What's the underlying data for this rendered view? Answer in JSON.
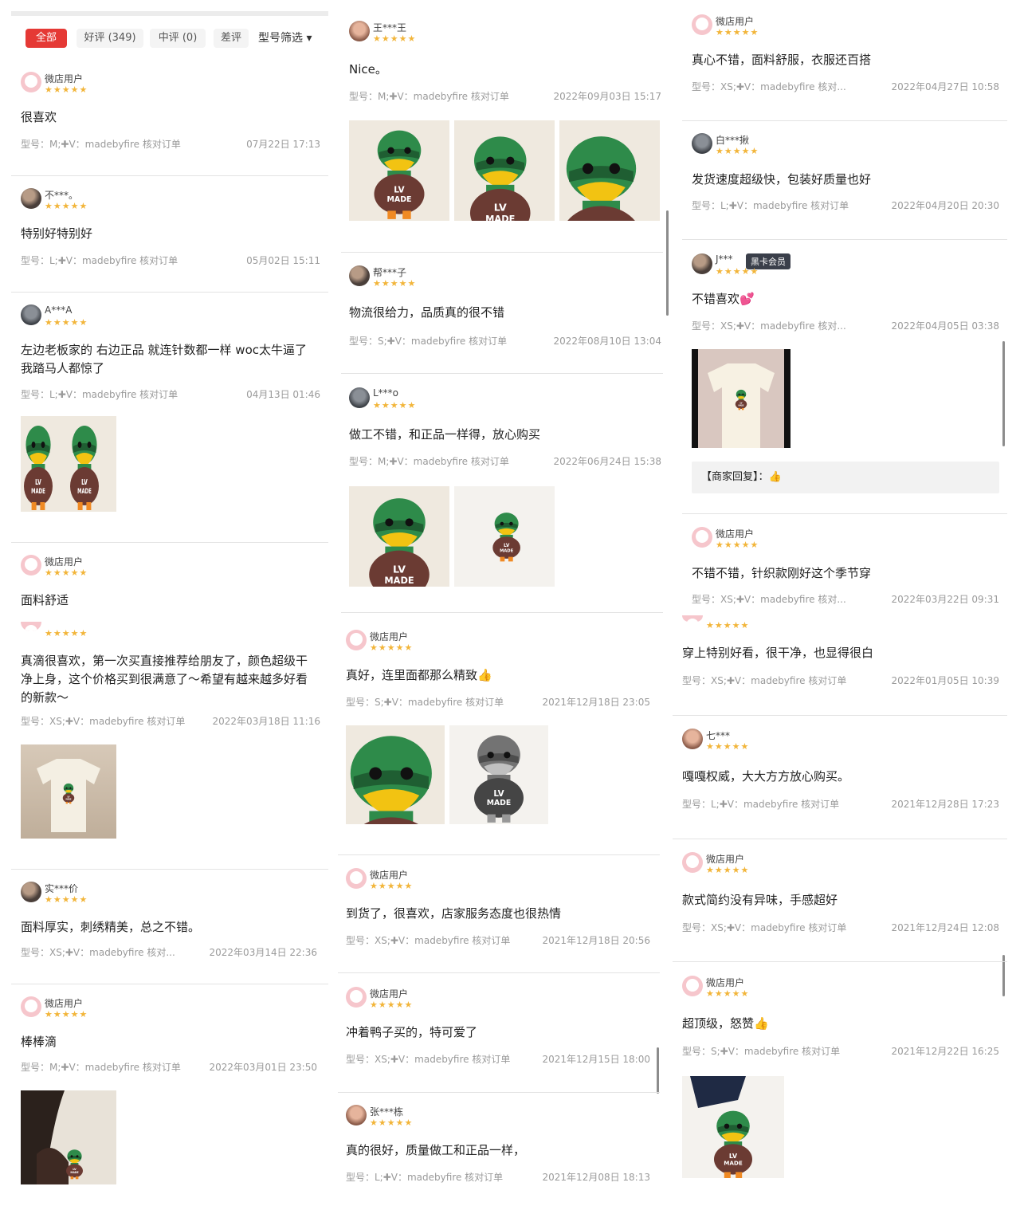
{
  "filters": {
    "tabs": [
      {
        "label": "全部"
      },
      {
        "label": "好评 (349)"
      },
      {
        "label": "中评 (0)"
      },
      {
        "label": "差评"
      }
    ],
    "dropdown": "型号筛选 ▾"
  },
  "colors": {
    "accent": "#e53935",
    "star": "#f2b53a"
  },
  "columns": [
    {
      "reviews": [
        {
          "user": "微店用户",
          "stars": "★★★★★",
          "content": "很喜欢",
          "meta": "型号：M;✚V：madebyfire 核对订单",
          "date": "07月22日 17:13"
        },
        {
          "user": "不***。",
          "stars": "★★★★★",
          "content": "特别好特别好",
          "meta": "型号：L;✚V：madebyfire 核对订单",
          "date": "05月02日 15:11"
        },
        {
          "user": "A***A",
          "stars": "★★★★★",
          "content": "左边老板家的 右边正品 就连针数都一样 woc太牛逼了 我踏马人都惊了",
          "meta": "型号：L;✚V：madebyfire 核对订单",
          "date": "04月13日 01:46"
        },
        {
          "user": "微店用户",
          "stars": "★★★★★",
          "content": "面料舒适",
          "meta": "",
          "date": ""
        },
        {
          "user": "微店用户",
          "stars": "★★★★★",
          "content": "真滴很喜欢，第一次买直接推荐给朋友了，颜色超级干净上身，这个价格买到很满意了～希望有越来越多好看的新款～",
          "meta": "型号：XS;✚V：madebyfire 核对订单",
          "date": "2022年03月18日 11:16"
        },
        {
          "user": "实***价",
          "stars": "★★★★★",
          "content": "面料厚实，刺绣精美，总之不错。",
          "meta": "型号：XS;✚V：madebyfire 核对...",
          "date": "2022年03月14日 22:36"
        },
        {
          "user": "微店用户",
          "stars": "★★★★★",
          "content": "棒棒滴",
          "meta": "型号：M;✚V：madebyfire 核对订单",
          "date": "2022年03月01日 23:50"
        }
      ]
    },
    {
      "reviews": [
        {
          "user": "王***王",
          "stars": "★★★★★",
          "content": "Nice。",
          "meta": "型号：M;✚V：madebyfire 核对订单",
          "date": "2022年09月03日 15:17"
        },
        {
          "user": "帮***子",
          "stars": "★★★★★",
          "content": "物流很给力，品质真的很不错",
          "meta": "型号：S;✚V：madebyfire 核对订单",
          "date": "2022年08月10日 13:04"
        },
        {
          "user": "L***o",
          "stars": "★★★★★",
          "content": "做工不错，和正品一样得，放心购买",
          "meta": "型号：M;✚V：madebyfire 核对订单",
          "date": "2022年06月24日 15:38"
        },
        {
          "user": "微店用户",
          "stars": "★★★★★",
          "content": "真好，连里面都那么精致👍",
          "meta": "型号：S;✚V：madebyfire 核对订单",
          "date": "2021年12月18日 23:05"
        },
        {
          "user": "微店用户",
          "stars": "★★★★★",
          "content": "到货了，很喜欢，店家服务态度也很热情",
          "meta": "型号：XS;✚V：madebyfire 核对订单",
          "date": "2021年12月18日 20:56"
        },
        {
          "user": "微店用户",
          "stars": "★★★★★",
          "content": "冲着鸭子买的，特可爱了",
          "meta": "型号：XS;✚V：madebyfire 核对订单",
          "date": "2021年12月15日 18:00"
        },
        {
          "user": "张***栋",
          "stars": "★★★★★",
          "content": "真的很好，质量做工和正品一样，",
          "meta": "型号：L;✚V：madebyfire 核对订单",
          "date": "2021年12月08日 18:13"
        }
      ]
    },
    {
      "reviews": [
        {
          "user": "微店用户",
          "stars": "★★★★★",
          "content": "真心不错，面料舒服，衣服还百搭",
          "meta": "型号：XS;✚V：madebyfire 核对...",
          "date": "2022年04月27日 10:58"
        },
        {
          "user": "白***揪",
          "stars": "★★★★★",
          "content": "发货速度超级快，包装好质量也好",
          "meta": "型号：L;✚V：madebyfire 核对订单",
          "date": "2022年04月20日 20:30"
        },
        {
          "user": "J***",
          "badge": "黑卡会员",
          "stars": "★★★★★",
          "content": "不错喜欢💕",
          "meta": "型号：XS;✚V：madebyfire 核对...",
          "date": "2022年04月05日 03:38",
          "reply": "【商家回复】：👍"
        },
        {
          "user": "微店用户",
          "stars": "★★★★★",
          "content": "不错不错，针织款刚好这个季节穿",
          "meta": "型号：XS;✚V：madebyfire 核对...",
          "date": "2022年03月22日 09:31"
        },
        {
          "user": "",
          "stars": "★★★★★",
          "content": "穿上特别好看，很干净，也显得很白",
          "meta": "型号：XS;✚V：madebyfire 核对订单",
          "date": "2022年01月05日 10:39"
        },
        {
          "user": "七***",
          "stars": "★★★★★",
          "content": "嘎嘎权威，大大方方放心购买。",
          "meta": "型号：L;✚V：madebyfire 核对订单",
          "date": "2021年12月28日 17:23"
        },
        {
          "user": "微店用户",
          "stars": "★★★★★",
          "content": "款式简约没有异味，手感超好",
          "meta": "型号：XS;✚V：madebyfire 核对订单",
          "date": "2021年12月24日 12:08"
        },
        {
          "user": "微店用户",
          "stars": "★★★★★",
          "content": "超顶级，怒赞👍",
          "meta": "型号：S;✚V：madebyfire 核对订单",
          "date": "2021年12月22日 16:25"
        }
      ]
    }
  ]
}
